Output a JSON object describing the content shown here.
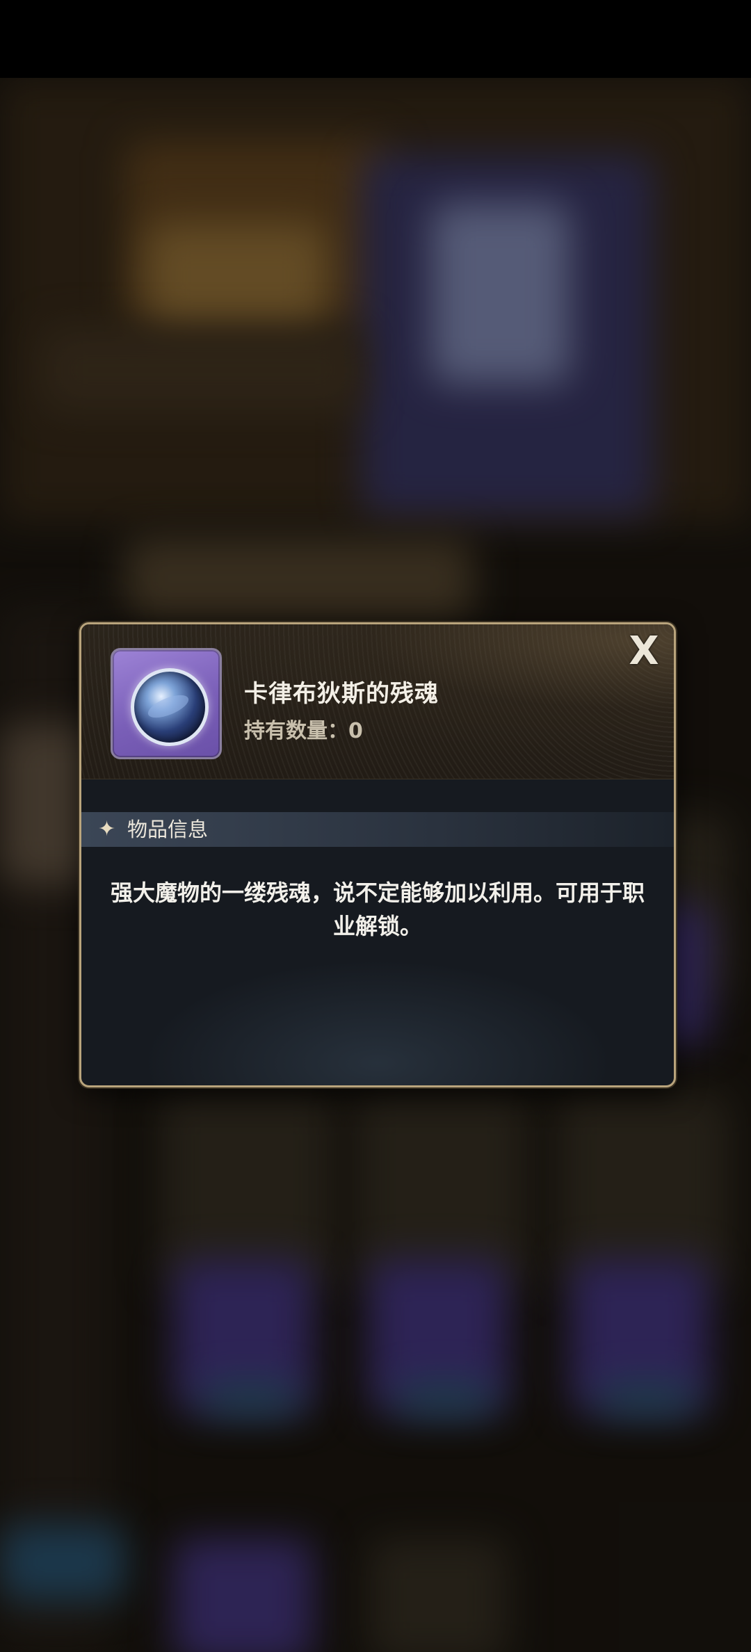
{
  "item": {
    "name": "卡律布狄斯的残魂",
    "quantity_text": "持有数量：0"
  },
  "dialog": {
    "close_icon": "X",
    "section_icon": "✦",
    "section_title": "物品信息",
    "description": "强大魔物的一缕残魂，说不定能够加以利用。可用于职业解锁。"
  },
  "colors": {
    "frame_gold": "#b9a47c",
    "icon_purple": "#7a5fb8"
  },
  "icons": {
    "item": "soul-orb-icon",
    "close": "close-icon",
    "section": "sparkle-icon"
  }
}
